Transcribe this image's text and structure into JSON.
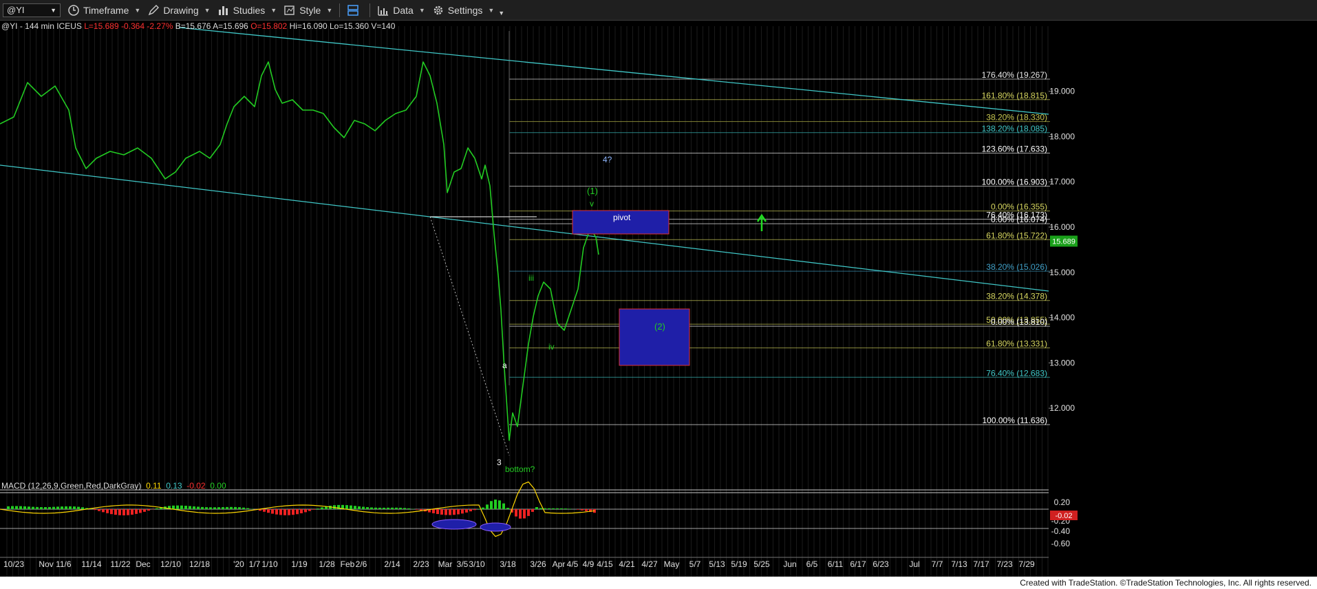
{
  "toolbar": {
    "symbol": "@YI",
    "items": [
      {
        "label": "Timeframe",
        "icon": "clock-icon"
      },
      {
        "label": "Drawing",
        "icon": "pencil-icon"
      },
      {
        "label": "Studies",
        "icon": "bars-icon"
      },
      {
        "label": "Style",
        "icon": "style-icon"
      },
      {
        "label": "Data",
        "icon": "data-icon"
      },
      {
        "label": "Settings",
        "icon": "gear-icon"
      }
    ]
  },
  "info": {
    "symbol_tf": "@YI - 144 min",
    "exchange": "ICEUS",
    "last": "L=15.689",
    "change": "-0.364",
    "pct": "-2.27%",
    "bid": "B=15.676",
    "ask": "A=15.696",
    "open": "O=15.802",
    "high": "Hi=16.090",
    "low": "Lo=15.360",
    "volume": "V=140"
  },
  "macd_header": {
    "label": "MACD (12,26,9,Green,Red,DarkGray)",
    "v1": "0.11",
    "v2": "0.13",
    "v3": "-0.02",
    "v4": "0.00"
  },
  "price_axis": {
    "ticks": [
      "19.000",
      "18.000",
      "17.000",
      "16.000",
      "15.000",
      "14.000",
      "13.000",
      "12.000"
    ],
    "last_price": "15.689"
  },
  "macd_axis": {
    "ticks": [
      "0.20",
      "-0.20",
      "-0.40",
      "-0.60"
    ],
    "badge": "-0.02"
  },
  "time_axis": [
    "10/23",
    "Nov 11/6",
    "11/14",
    "11/22",
    "Dec",
    "12/10",
    "12/18",
    "'20",
    "1/7",
    "1/10",
    "1/19",
    "1/28",
    "Feb",
    "2/6",
    "2/14",
    "2/23",
    "Mar",
    "3/5",
    "3/10",
    "3/18",
    "3/26",
    "Apr",
    "4/5",
    "4/9",
    "4/15",
    "4/21",
    "4/27",
    "May",
    "5/7",
    "5/13",
    "5/19",
    "5/25",
    "Jun",
    "6/5",
    "6/11",
    "6/17",
    "6/23",
    "Jul",
    "7/7",
    "7/13",
    "7/17",
    "7/23",
    "7/29"
  ],
  "fib_labels": [
    {
      "text": "176.40% (19.267)",
      "color": "#e8e8e8",
      "price": 19.267
    },
    {
      "text": "161.80% (18.815)",
      "color": "#d8d860",
      "price": 18.815
    },
    {
      "text": "38.20% (18.330)",
      "color": "#c8c850",
      "price": 18.33
    },
    {
      "text": "138.20% (18.085)",
      "color": "#40c8c8",
      "price": 18.085
    },
    {
      "text": "123.60% (17.633)",
      "color": "#ffffff",
      "price": 17.633
    },
    {
      "text": "100.00% (16.903)",
      "color": "#ffffff",
      "price": 16.903
    },
    {
      "text": "0.00% (16.355)",
      "color": "#d8d860",
      "price": 16.355
    },
    {
      "text": "76.40% (16.173)",
      "color": "#ffffff",
      "price": 16.173
    },
    {
      "text": "0.00% (16.074)",
      "color": "#ffffff",
      "price": 16.074
    },
    {
      "text": "61.80% (15.722)",
      "color": "#d8d860",
      "price": 15.722
    },
    {
      "text": "38.20% (15.026)",
      "color": "#40a0c8",
      "price": 15.026
    },
    {
      "text": "38.20% (14.378)",
      "color": "#d8d860",
      "price": 14.378
    },
    {
      "text": "50.00% (13.855)",
      "color": "#d8d860",
      "price": 13.855
    },
    {
      "text": "0.00% (13.810)",
      "color": "#ffffff",
      "price": 13.81
    },
    {
      "text": "61.80% (13.331)",
      "color": "#d8d860",
      "price": 13.331
    },
    {
      "text": "76.40% (12.683)",
      "color": "#40c8c8",
      "price": 12.683
    },
    {
      "text": "100.00% (11.636)",
      "color": "#ffffff",
      "price": 11.636
    }
  ],
  "annotations": {
    "wave_1": "(1)",
    "wave_v": "v",
    "wave_4q": "4?",
    "pivot": "pivot",
    "wave_2": "(2)",
    "wave_iii": "iii",
    "wave_iv": "iv",
    "wave_a": "a",
    "wave_3": "3",
    "bottom": "bottom?"
  },
  "colors": {
    "price_line": "#22cc22",
    "channel": "#40c8c8",
    "pivot_box": "#1f1fa8",
    "box_border": "#e03030",
    "up_arrow": "#22dd22",
    "macd_pos": "#22cc22",
    "macd_neg": "#ee2222"
  },
  "footer": "Created with TradeStation. ©TradeStation Technologies, Inc. All rights reserved."
}
